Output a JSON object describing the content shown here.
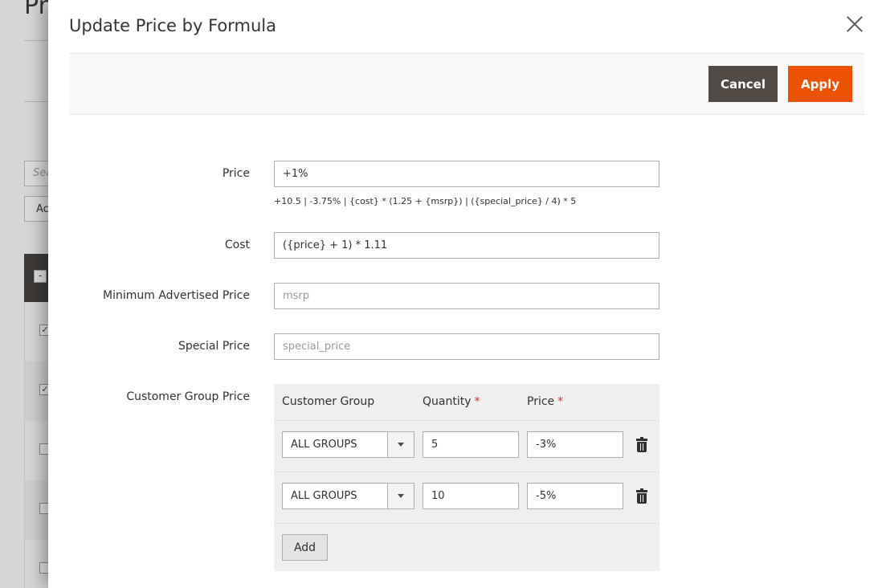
{
  "background": {
    "title": "Pro",
    "search_placeholder": "Sea",
    "actions_label": "Ac",
    "header_box": "-"
  },
  "modal": {
    "title": "Update Price by Formula",
    "cancel_label": "Cancel",
    "apply_label": "Apply"
  },
  "form": {
    "price": {
      "label": "Price",
      "value": "+1%",
      "note": "+10.5 | -3.75% | {cost} * (1.25 + {msrp}) | ({special_price} / 4) * 5"
    },
    "cost": {
      "label": "Cost",
      "value": "({price} + 1) * 1.11"
    },
    "msrp": {
      "label": "Minimum Advertised Price",
      "placeholder": "msrp"
    },
    "special_price": {
      "label": "Special Price",
      "placeholder": "special_price"
    },
    "customer_group_price": {
      "label": "Customer Group Price",
      "columns": {
        "group": "Customer Group",
        "quantity": "Quantity",
        "price": "Price",
        "required_mark": "*"
      },
      "rows": [
        {
          "group": "ALL GROUPS",
          "quantity": "5",
          "price": "-3%"
        },
        {
          "group": "ALL GROUPS",
          "quantity": "10",
          "price": "-5%"
        }
      ],
      "add_label": "Add"
    }
  },
  "colors": {
    "accent": "#eb5202",
    "secondary": "#514943",
    "required": "#e22626"
  },
  "icons": {
    "close": "close-icon",
    "delete": "trash-icon",
    "dropdown": "chevron-down-icon"
  }
}
